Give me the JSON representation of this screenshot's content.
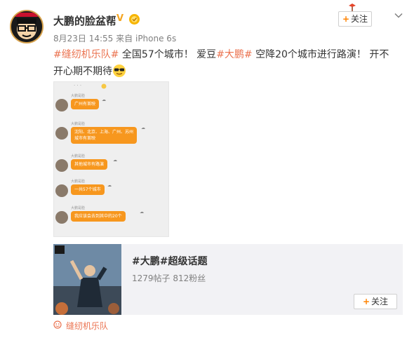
{
  "post": {
    "username": "大鹏的脸盆帮",
    "verified_mark": "V",
    "time": "8月23日 14:55",
    "source_prefix": "来自",
    "device": "iPhone 6s",
    "follow_label": "关注",
    "follow_plus": "+",
    "content": {
      "tag1": "#缝纫机乐队#",
      "text1": " 全国57个城市！ 爱豆",
      "tag2": "#大鹏#",
      "text2": " 空降20个城市进行路演！ 开不开心期不期待"
    }
  },
  "screenshot": {
    "messages": [
      {
        "name": "大鹏是脸",
        "text": "广州有首映",
        "icon": "☁"
      },
      {
        "name": "大鹏是脸",
        "text": "沈阳、北京、上海、广州、苏州",
        "text2": "城市有首映",
        "icon": "☁"
      },
      {
        "name": "大鹏是脸",
        "text": "其他城市有路演",
        "icon": "☁"
      },
      {
        "name": "大鹏是脸",
        "text": "一共57个城市",
        "icon": "☁"
      },
      {
        "name": "大鹏是脸",
        "text": "我应该会去到其中的20个",
        "icon": "☁"
      }
    ],
    "top_marks": "· ·  ·"
  },
  "topic_card": {
    "title": "#大鹏#超级话题",
    "stats": "1279帖子  812粉丝",
    "follow_label": "关注",
    "follow_plus": "+"
  },
  "source_link": {
    "label": "缝纫机乐队"
  },
  "colors": {
    "accent": "#ff8200",
    "link": "#eb7350",
    "bubble": "#f7971e"
  },
  "icons": {
    "verified": "verified-v-icon",
    "chevron": "chevron-down-icon",
    "emoji": "sunglasses-emoji-icon",
    "source": "topic-source-icon"
  }
}
